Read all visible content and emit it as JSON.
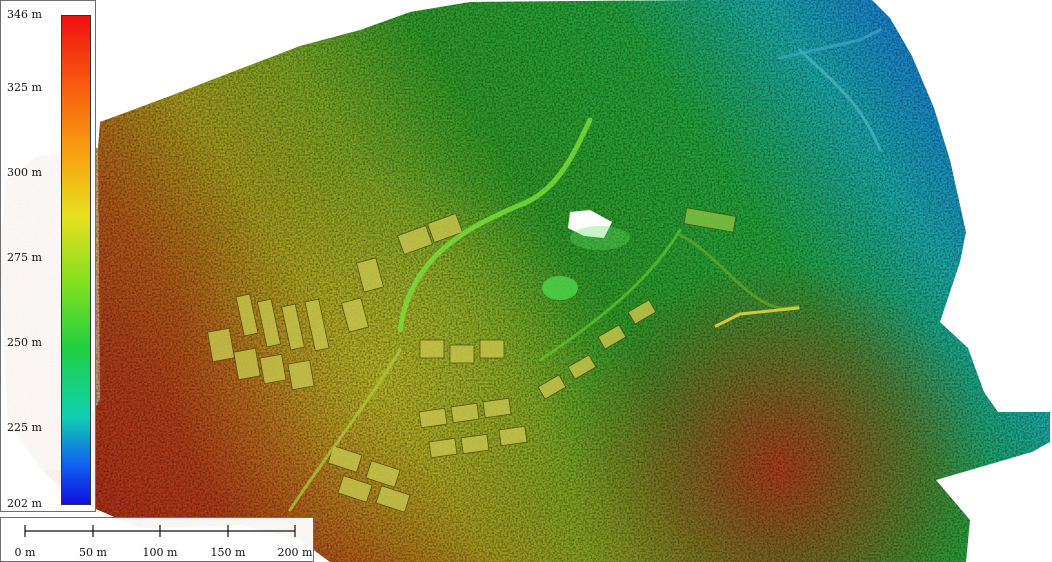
{
  "legend": {
    "labels": [
      "346 m",
      "325 m",
      "300 m",
      "275 m",
      "250 m",
      "225 m",
      "202 m"
    ]
  },
  "scalebar": {
    "labels": [
      "0 m",
      "50 m",
      "100 m",
      "150 m",
      "200 m"
    ]
  }
}
